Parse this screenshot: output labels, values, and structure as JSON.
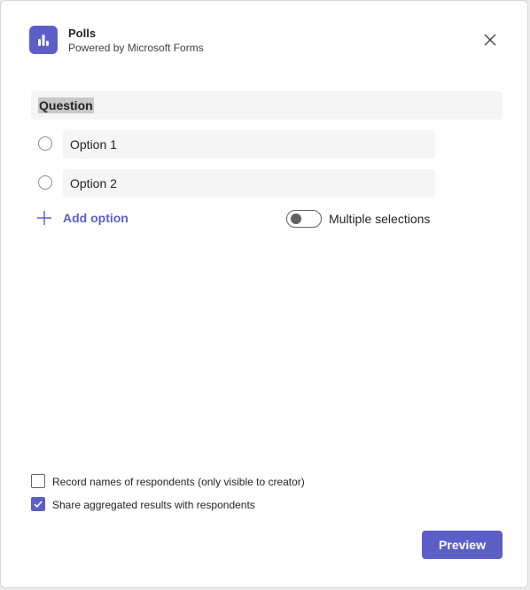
{
  "header": {
    "app_name": "Polls",
    "app_subtitle": "Powered by Microsoft Forms",
    "app_icon": "poll-chart-icon",
    "close_icon": "close-icon"
  },
  "form": {
    "question_value": "Question",
    "options": [
      {
        "value": "Option 1",
        "selected": false
      },
      {
        "value": "Option 2",
        "selected": false
      }
    ],
    "add_option_label": "Add option",
    "multiple_selections_label": "Multiple selections",
    "multiple_selections_on": false
  },
  "settings": {
    "record_names_label": "Record names of respondents (only visible to creator)",
    "record_names_checked": false,
    "share_results_label": "Share aggregated results with respondents",
    "share_results_checked": true
  },
  "footer": {
    "preview_label": "Preview"
  },
  "colors": {
    "accent": "#5b5fc7",
    "field_background": "#f5f5f5"
  }
}
